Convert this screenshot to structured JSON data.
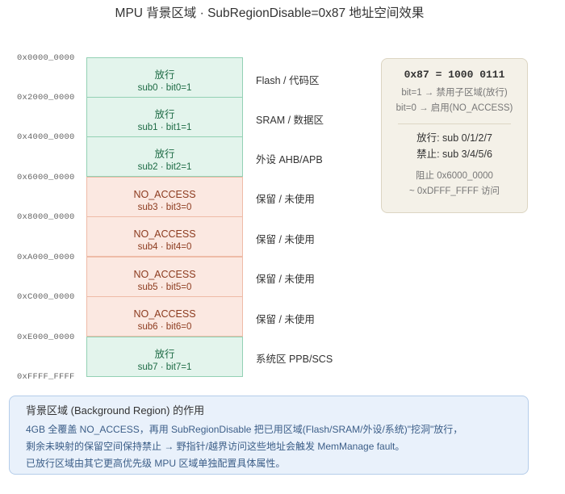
{
  "title": "MPU 背景区域 · SubRegionDisable=0x87 地址空间效果",
  "addresses": [
    "0x0000_0000",
    "0x2000_0000",
    "0x4000_0000",
    "0x6000_0000",
    "0x8000_0000",
    "0xA000_0000",
    "0xC000_0000",
    "0xE000_0000",
    "0xFFFF_FFFF"
  ],
  "subregions": [
    {
      "status": "放行",
      "label": "sub0 · bit0=1",
      "region": "Flash / 代码区",
      "allowed": true
    },
    {
      "status": "放行",
      "label": "sub1 · bit1=1",
      "region": "SRAM / 数据区",
      "allowed": true
    },
    {
      "status": "放行",
      "label": "sub2 · bit2=1",
      "region": "外设 AHB/APB",
      "allowed": true
    },
    {
      "status": "NO_ACCESS",
      "label": "sub3 · bit3=0",
      "region": "保留 / 未使用",
      "allowed": false
    },
    {
      "status": "NO_ACCESS",
      "label": "sub4 · bit4=0",
      "region": "保留 / 未使用",
      "allowed": false
    },
    {
      "status": "NO_ACCESS",
      "label": "sub5 · bit5=0",
      "region": "保留 / 未使用",
      "allowed": false
    },
    {
      "status": "NO_ACCESS",
      "label": "sub6 · bit6=0",
      "region": "保留 / 未使用",
      "allowed": false
    },
    {
      "status": "放行",
      "label": "sub7 · bit7=1",
      "region": "系统区 PPB/SCS",
      "allowed": true
    }
  ],
  "info": {
    "code": "0x87 = 1000 0111",
    "line1": "bit=1 → 禁用子区域(放行)",
    "line2": "bit=0 → 启用(NO_ACCESS)",
    "allowed": "放行: sub 0/1/2/7",
    "denied": "禁止: sub 3/4/5/6",
    "block1": "阻止 0x6000_0000",
    "block2": "~ 0xDFFF_FFFF 访问"
  },
  "note": {
    "heading": "背景区域 (Background Region) 的作用",
    "p1": "4GB 全覆盖 NO_ACCESS，再用 SubRegionDisable 把已用区域(Flash/SRAM/外设/系统)\"挖洞\"放行，",
    "p2": "剩余未映射的保留空间保持禁止 → 野指针/越界访问这些地址会触发 MemManage fault。",
    "p3": "已放行区域由其它更高优先级 MPU 区域单独配置具体属性。"
  }
}
